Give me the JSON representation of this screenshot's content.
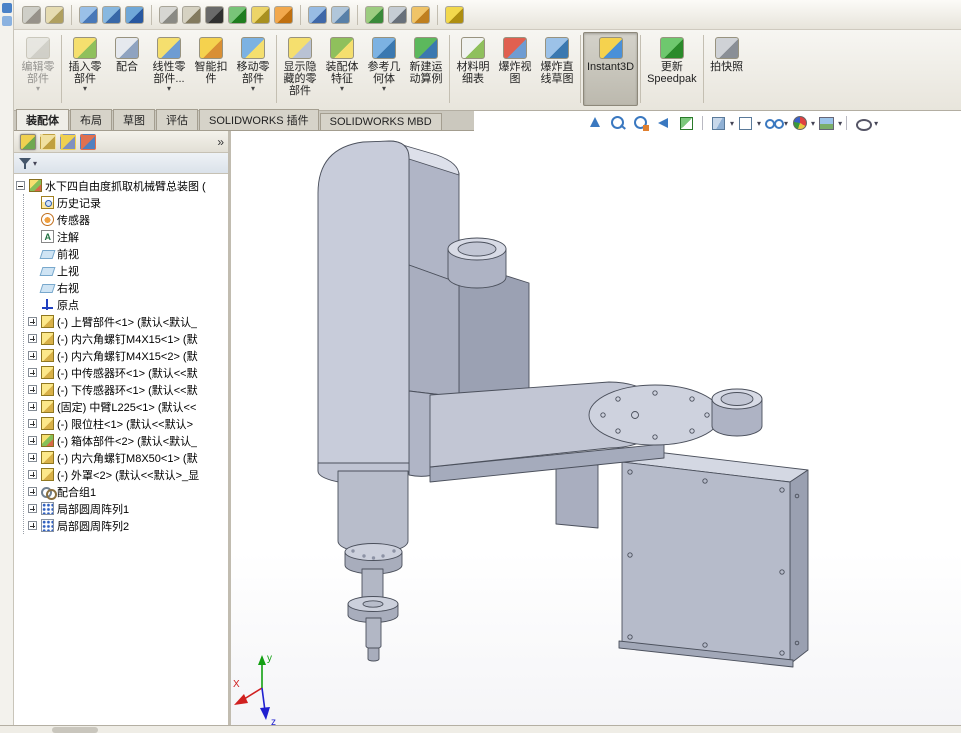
{
  "quick_toolbar": {
    "icons": [
      "attach-icon",
      "ruler-icon",
      "display-icon",
      "chart-icon",
      "web-icon",
      "settings-gear-icon",
      "tools-gear-icon",
      "filter-cone-icon",
      "map-pin-icon",
      "measure-icon",
      "grid-add-icon",
      "zoom-icon",
      "search-doc-icon",
      "table-icon",
      "print-icon",
      "note-icon",
      "pushpin-icon"
    ]
  },
  "ribbon": {
    "buttons": [
      {
        "icon": "edit-component-icon",
        "label_lines": [
          "编辑零",
          "部件"
        ],
        "enabled": false,
        "dropdown": true
      },
      {
        "icon": "insert-component-icon",
        "label_lines": [
          "插入零",
          "部件"
        ],
        "enabled": true,
        "dropdown": true
      },
      {
        "icon": "mate-icon",
        "label_lines": [
          "配合"
        ],
        "enabled": true,
        "dropdown": false
      },
      {
        "icon": "linear-pattern-icon",
        "label_lines": [
          "线性零",
          "部件..."
        ],
        "enabled": true,
        "dropdown": true
      },
      {
        "icon": "smart-fastener-icon",
        "label_lines": [
          "智能扣",
          "件"
        ],
        "enabled": true,
        "dropdown": false
      },
      {
        "icon": "move-component-icon",
        "label_lines": [
          "移动零",
          "部件"
        ],
        "enabled": true,
        "dropdown": true
      },
      {
        "icon": "show-hidden-icon",
        "label_lines": [
          "显示隐",
          "藏的零",
          "部件"
        ],
        "enabled": true,
        "dropdown": false
      },
      {
        "icon": "assembly-feature-icon",
        "label_lines": [
          "装配体",
          "特征"
        ],
        "enabled": true,
        "dropdown": true
      },
      {
        "icon": "reference-geometry-icon",
        "label_lines": [
          "参考几",
          "何体"
        ],
        "enabled": true,
        "dropdown": true
      },
      {
        "icon": "motion-study-icon",
        "label_lines": [
          "新建运",
          "动算例"
        ],
        "enabled": true,
        "dropdown": false
      },
      {
        "icon": "bom-icon",
        "label_lines": [
          "材料明",
          "细表"
        ],
        "enabled": true,
        "dropdown": false
      },
      {
        "icon": "exploded-view-icon",
        "label_lines": [
          "爆炸视",
          "图"
        ],
        "enabled": true,
        "dropdown": false
      },
      {
        "icon": "explode-line-sketch-icon",
        "label_lines": [
          "爆炸直",
          "线草图"
        ],
        "enabled": true,
        "dropdown": false
      },
      {
        "icon": "instant3d-icon",
        "label_lines": [
          "Instant3D"
        ],
        "enabled": true,
        "active": true
      },
      {
        "icon": "speedpak-icon",
        "label_lines": [
          "更新",
          "Speedpak"
        ],
        "enabled": true,
        "dropdown": false
      },
      {
        "icon": "snapshot-icon",
        "label_lines": [
          "拍快照"
        ],
        "enabled": true,
        "dropdown": false
      }
    ]
  },
  "tabs": [
    {
      "label": "装配体",
      "active": true
    },
    {
      "label": "布局"
    },
    {
      "label": "草图"
    },
    {
      "label": "评估"
    },
    {
      "label": "SOLIDWORKS 插件"
    },
    {
      "label": "SOLIDWORKS MBD"
    }
  ],
  "view_toolbar": {
    "icons": [
      "zoom-fit-arrow-icon",
      "zoom-fit-icon",
      "zoom-area-icon",
      "previous-view-icon",
      "section-view-icon",
      "view-orientation-icon",
      "display-style-icon",
      "hide-show-items-icon",
      "edit-appearance-icon",
      "apply-scene-icon",
      "view-settings-icon"
    ]
  },
  "tree": {
    "expand_hint": "»",
    "header_tabs": [
      "featuremanager-tab",
      "propertymanager-tab",
      "configurationmanager-tab",
      "displaymanager-tab"
    ],
    "items": [
      {
        "label": "水下四自由度抓取机械臂总装图 (",
        "icon": "assembly",
        "expander": "minus"
      },
      {
        "label": "历史记录",
        "icon": "history",
        "expander": "none"
      },
      {
        "label": "传感器",
        "icon": "sensor",
        "expander": "none"
      },
      {
        "label": "注解",
        "icon": "annotation",
        "expander": "none"
      },
      {
        "label": "前视",
        "icon": "plane",
        "expander": "none"
      },
      {
        "label": "上视",
        "icon": "plane",
        "expander": "none"
      },
      {
        "label": "右视",
        "icon": "plane",
        "expander": "none"
      },
      {
        "label": "原点",
        "icon": "origin",
        "expander": "none"
      },
      {
        "label": "(-) 上臂部件<1> (默认<默认_",
        "icon": "part",
        "expander": "plus"
      },
      {
        "label": "(-) 内六角螺钉M4X15<1> (默",
        "icon": "part",
        "expander": "plus"
      },
      {
        "label": "(-) 内六角螺钉M4X15<2> (默",
        "icon": "part",
        "expander": "plus"
      },
      {
        "label": "(-) 中传感器环<1> (默认<<默",
        "icon": "part",
        "expander": "plus"
      },
      {
        "label": "(-) 下传感器环<1> (默认<<默",
        "icon": "part",
        "expander": "plus"
      },
      {
        "label": "(固定) 中臂L225<1> (默认<<",
        "icon": "part",
        "expander": "plus"
      },
      {
        "label": "(-) 限位柱<1> (默认<<默认>",
        "icon": "part",
        "expander": "plus"
      },
      {
        "label": "(-) 箱体部件<2> (默认<默认_",
        "icon": "assembly",
        "expander": "plus"
      },
      {
        "label": "(-) 内六角螺钉M8X50<1> (默",
        "icon": "part",
        "expander": "plus"
      },
      {
        "label": "(-) 外罩<2> (默认<<默认>_显",
        "icon": "part",
        "expander": "plus"
      },
      {
        "label": "配合组1",
        "icon": "mates",
        "expander": "plus"
      },
      {
        "label": "局部圆周阵列1",
        "icon": "pattern",
        "expander": "plus"
      },
      {
        "label": "局部圆周阵列2",
        "icon": "pattern",
        "expander": "plus"
      }
    ]
  },
  "viewport": {
    "triad": {
      "x_label": "X",
      "y_label": "y",
      "z_label": "z"
    }
  },
  "colors": {
    "model_body": "#c8ccda",
    "model_side": "#a9aebf",
    "model_top": "#dde0ea",
    "accent_blue": "#3a78c0"
  }
}
